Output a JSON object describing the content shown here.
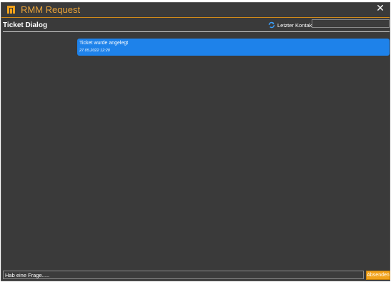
{
  "window": {
    "title": "RMM Request",
    "close_glyph": "✕",
    "accent_color": "#e8a33a"
  },
  "header": {
    "title": "Ticket Dialog",
    "refresh_icon": "refresh-icon",
    "last_contact_label": "Letzter Kontakt:",
    "last_contact_value": ""
  },
  "messages": [
    {
      "text": "Ticket wurde angelegt",
      "timestamp": "27.05.2022 12:20",
      "color": "#1e82ea"
    }
  ],
  "composer": {
    "placeholder": "Hab eine Frage.....",
    "send_label": "Absenden",
    "send_color": "#f2a21b"
  }
}
